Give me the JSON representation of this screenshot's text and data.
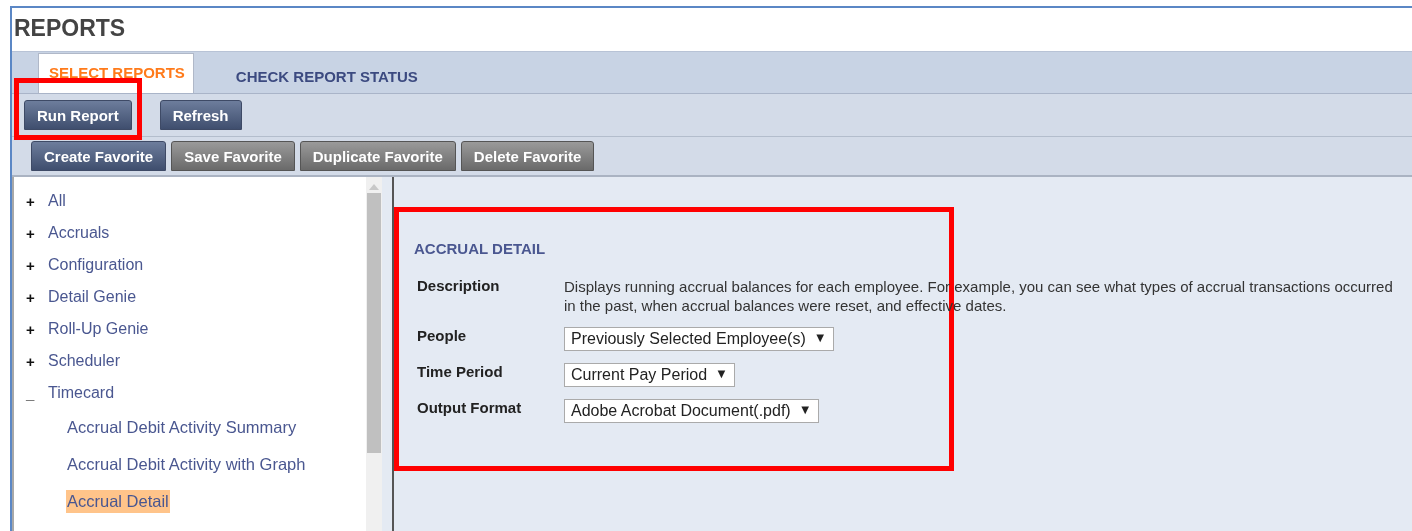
{
  "title": "REPORTS",
  "tabs": [
    {
      "label": "SELECT REPORTS",
      "selected": true
    },
    {
      "label": "CHECK REPORT STATUS",
      "selected": false
    }
  ],
  "actions": [
    {
      "label": "Run Report",
      "highlighted": true
    },
    {
      "label": "Refresh",
      "highlighted": false
    }
  ],
  "favorite_actions": [
    {
      "label": "Create Favorite",
      "primary": true
    },
    {
      "label": "Save Favorite",
      "primary": false
    },
    {
      "label": "Duplicate Favorite",
      "primary": false
    },
    {
      "label": "Delete Favorite",
      "primary": false
    }
  ],
  "tree": [
    {
      "toggle": "+",
      "label": "All"
    },
    {
      "toggle": "+",
      "label": "Accruals"
    },
    {
      "toggle": "+",
      "label": "Configuration"
    },
    {
      "toggle": "+",
      "label": "Detail Genie"
    },
    {
      "toggle": "+",
      "label": "Roll-Up Genie"
    },
    {
      "toggle": "+",
      "label": "Scheduler"
    },
    {
      "toggle": "_",
      "label": "Timecard",
      "children": [
        {
          "label": "Accrual Debit Activity Summary",
          "selected": false
        },
        {
          "label": "Accrual Debit Activity with Graph",
          "selected": false
        },
        {
          "label": "Accrual Detail",
          "selected": true
        }
      ]
    }
  ],
  "detail": {
    "heading": "ACCRUAL DETAIL",
    "highlighted": true,
    "description_label": "Description",
    "description": "Displays running accrual balances for each employee. For example, you can see what types of accrual transactions occurred in the past, when accrual balances were reset, and effective dates.",
    "fields": [
      {
        "label": "People",
        "value": "Previously Selected Employee(s)",
        "caret": "▼"
      },
      {
        "label": "Time Period",
        "value": "Current Pay Period",
        "caret": "▼"
      },
      {
        "label": "Output Format",
        "value": "Adobe Acrobat Document(.pdf)",
        "caret": "▼"
      }
    ]
  }
}
